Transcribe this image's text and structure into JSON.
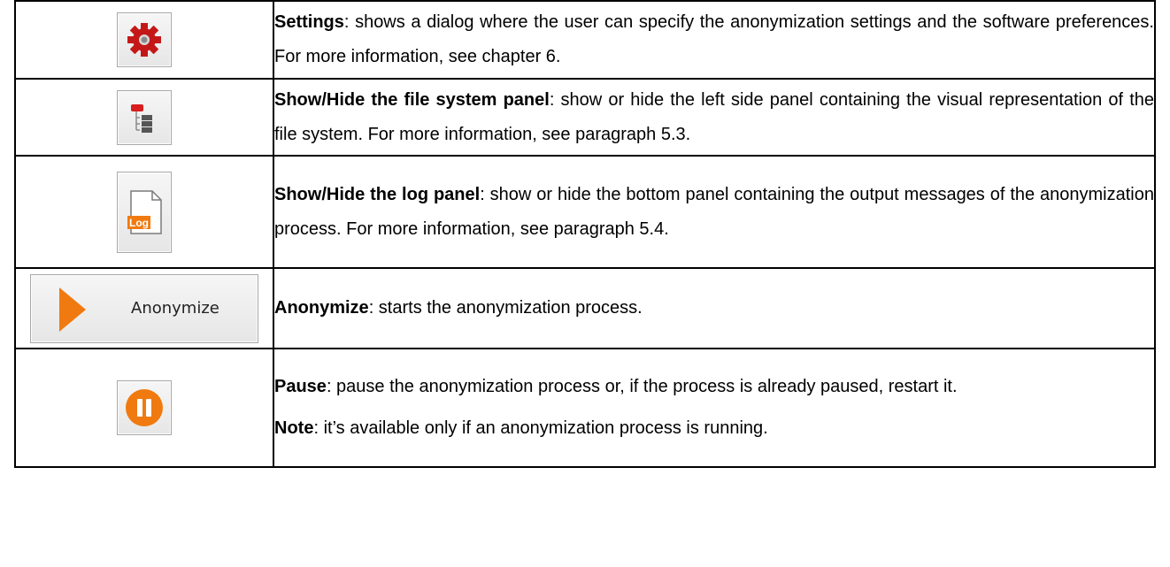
{
  "rows": [
    {
      "icon": "gear-icon",
      "title": "Settings",
      "text": ": shows a dialog where the user can specify the anonymization settings and the software preferences. For more information, see chapter 6."
    },
    {
      "icon": "tree-panel-icon",
      "title": "Show/Hide the file system panel",
      "text": ": show or hide the left side panel containing the visual representation of the file system. For more information, see paragraph 5.3."
    },
    {
      "icon": "log-file-icon",
      "icon_text": "Log",
      "title": "Show/Hide the log panel",
      "text": ": show or hide the bottom panel containing the output messages of the anonymization process. For more information, see paragraph 5.4."
    },
    {
      "icon": "play-icon",
      "button_label": "Anonymize",
      "title": "Anonymize",
      "text": ": starts the anonymization process."
    },
    {
      "icon": "pause-icon",
      "title": "Pause",
      "text": ": pause the anonymization process or, if the process is already paused, restart it.",
      "note_title": "Note",
      "note_text": ": it’s available only if an anonymization process is running."
    }
  ],
  "colors": {
    "gear": "#c41818",
    "accent_orange": "#f07a10",
    "tree_red": "#d81e1e",
    "tree_gray": "#555555"
  }
}
